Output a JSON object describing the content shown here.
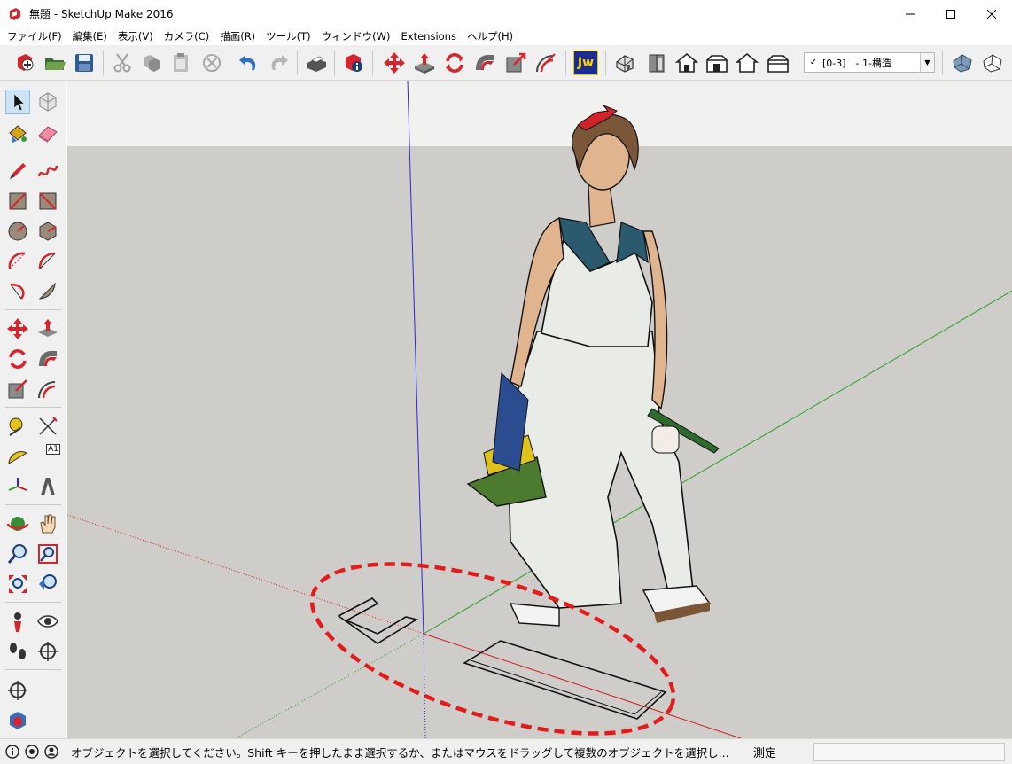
{
  "window": {
    "title": "無題 - SketchUp Make 2016",
    "app_icon": "sketchup-logo-icon",
    "controls": [
      "minimize-icon",
      "maximize-icon",
      "close-icon"
    ]
  },
  "menu": {
    "items": [
      {
        "label": "ファイル(F)"
      },
      {
        "label": "編集(E)"
      },
      {
        "label": "表示(V)"
      },
      {
        "label": "カメラ(C)"
      },
      {
        "label": "描画(R)"
      },
      {
        "label": "ツール(T)"
      },
      {
        "label": "ウィンドウ(W)"
      },
      {
        "label": "Extensions"
      },
      {
        "label": "ヘルプ(H)"
      }
    ]
  },
  "toolbar": {
    "icons": [
      "new-icon",
      "open-icon",
      "save-icon",
      "cut-icon",
      "copy-icon",
      "paste-icon",
      "erase-icon",
      "undo-icon",
      "redo-icon",
      "print-icon",
      "model-info-icon",
      "move-icon",
      "push-pull-icon",
      "rotate-icon",
      "follow-me-icon",
      "scale-icon",
      "offset-icon",
      "jw-export-icon",
      "iso-view-icon",
      "top-view-icon",
      "front-view-icon",
      "right-view-icon",
      "back-view-icon",
      "left-view-icon",
      "xray-style-icon",
      "wireframe-style-icon"
    ],
    "layer": {
      "checked": "✓",
      "value": "[0-3]　- 1-構造"
    },
    "jw_label": "Jw"
  },
  "left_toolbar": {
    "icons": [
      "select-icon",
      "make-component-icon",
      "paint-bucket-icon",
      "eraser-icon",
      "pencil-line-icon",
      "freehand-icon",
      "rectangle-icon",
      "rotated-rectangle-icon",
      "circle-icon",
      "polygon-icon",
      "arc-icon",
      "two-point-arc-icon",
      "three-point-arc-icon",
      "pie-icon",
      "move-icon",
      "push-pull-icon",
      "rotate-icon",
      "follow-me-icon",
      "scale-icon",
      "offset-icon",
      "tape-measure-icon",
      "dimension-icon",
      "protractor-icon",
      "text-icon",
      "axes-icon",
      "3d-text-icon",
      "orbit-icon",
      "pan-icon",
      "zoom-icon",
      "zoom-window-icon",
      "zoom-extents-icon",
      "previous-view-icon",
      "position-camera-icon",
      "look-around-icon",
      "walk-icon",
      "section-plane-icon",
      "section-display-icon",
      "warehouse-icon"
    ],
    "text_tool_label": "A1"
  },
  "status": {
    "message": "オブジェクトを選択してください。Shift キーを押したまま選択するか、またはマウスをドラッグして複数のオブジェクトを選択し...",
    "measure_label": "測定",
    "measure_value": ""
  },
  "colors": {
    "annotation": "#e21b1b",
    "axis_red": "#d21a1a",
    "axis_green": "#2aa02a",
    "axis_blue": "#2a2ad2",
    "ground": "#cfcdca",
    "sky": "#f1f1f0"
  }
}
